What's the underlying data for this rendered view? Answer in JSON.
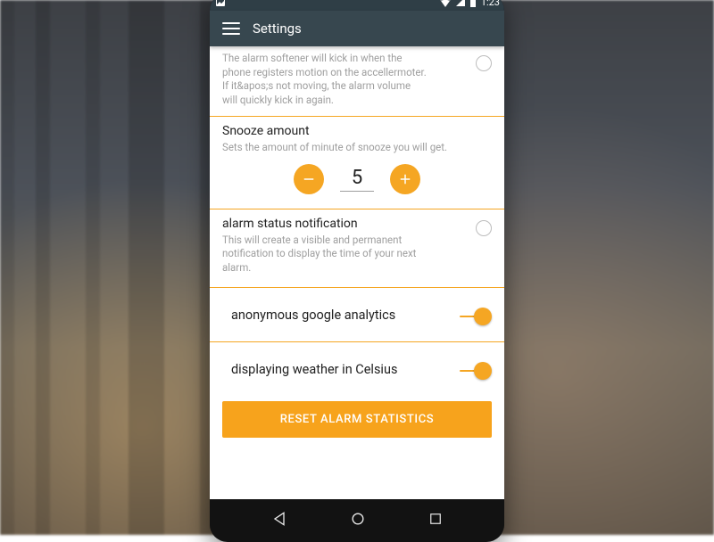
{
  "status": {
    "time": "1:23"
  },
  "appbar": {
    "title": "Settings"
  },
  "softener": {
    "desc": "The alarm softener will kick in when the phone registers motion on the accellermoter. If it&apos;s not moving, the alarm volume will quickly kick in again.",
    "on": false
  },
  "snooze": {
    "title": "Snooze amount",
    "desc": "Sets the amount of minute of snooze you will get.",
    "value": "5"
  },
  "notif": {
    "title": "alarm status notification",
    "desc": "This will create a visible and permanent notification to display the time of your next alarm.",
    "on": false
  },
  "analytics": {
    "label": "anonymous google analytics",
    "on": true
  },
  "celsius": {
    "label": "displaying weather in Celsius",
    "on": true
  },
  "reset": {
    "label": "RESET ALARM STATISTICS"
  },
  "colors": {
    "accent": "#f5a623",
    "appbar": "#37474f"
  }
}
